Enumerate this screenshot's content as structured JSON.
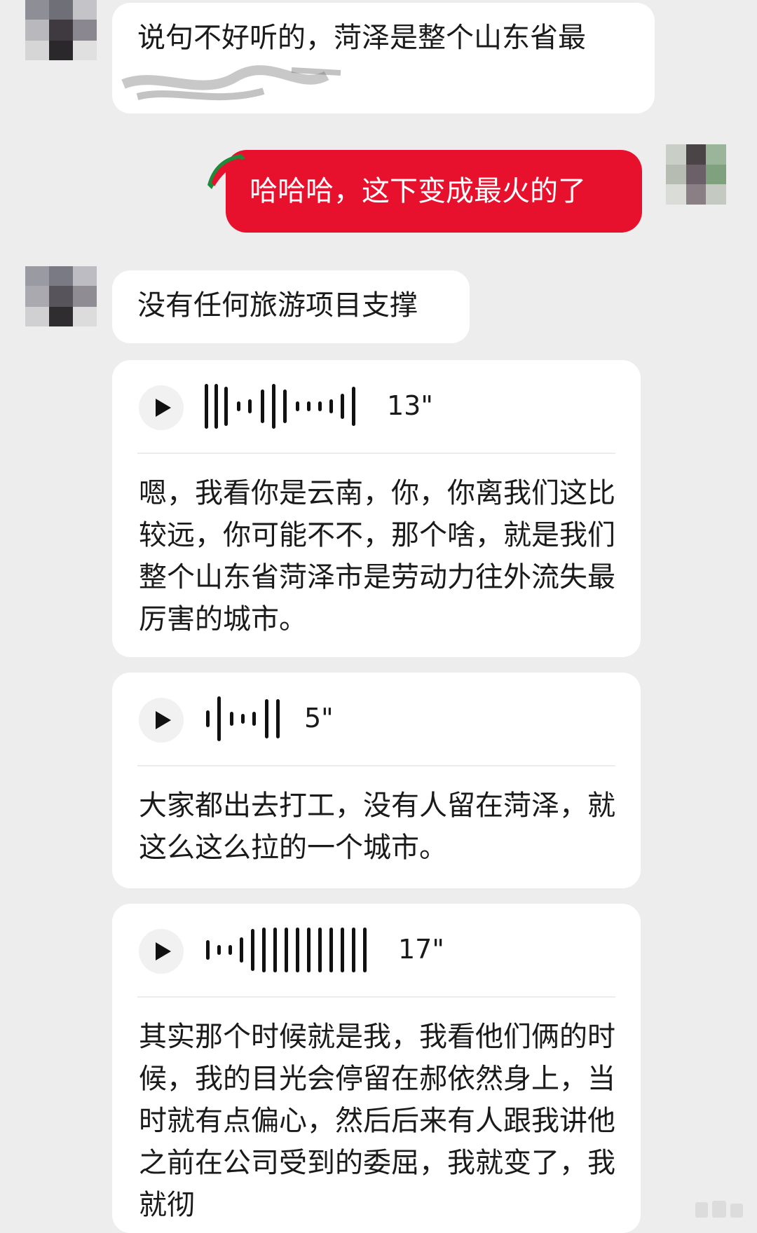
{
  "messages": {
    "m1": {
      "text": "说句不好听的，菏泽是整个山东省最"
    },
    "m2": {
      "text": "哈哈哈，这下变成最火的了"
    },
    "m3": {
      "text": "没有任何旅游项目支撑"
    },
    "v1": {
      "duration": "13\"",
      "transcript": "嗯，我看你是云南，你，你离我们这比较远，你可能不不，那个啥，就是我们整个山东省菏泽市是劳动力往外流失最厉害的城市。"
    },
    "v2": {
      "duration": "5\"",
      "transcript": "大家都出去打工，没有人留在菏泽，就这么这么拉的一个城市。"
    },
    "v3": {
      "duration": "17\"",
      "transcript": "其实那个时候就是我，我看他们俩的时候，我的目光会停留在郝依然身上，当时就有点偏心，然后后来有人跟我讲他之前在公司受到的委屈，我就变了，我就彻"
    }
  },
  "colors": {
    "background": "#ededed",
    "bubble_received": "#ffffff",
    "bubble_sent": "#e8112d",
    "text": "#1a1a1a"
  },
  "icons": {
    "play": "play-icon",
    "watermelon": "watermelon-badge-icon",
    "waveform": "voice-waveform-icon"
  }
}
